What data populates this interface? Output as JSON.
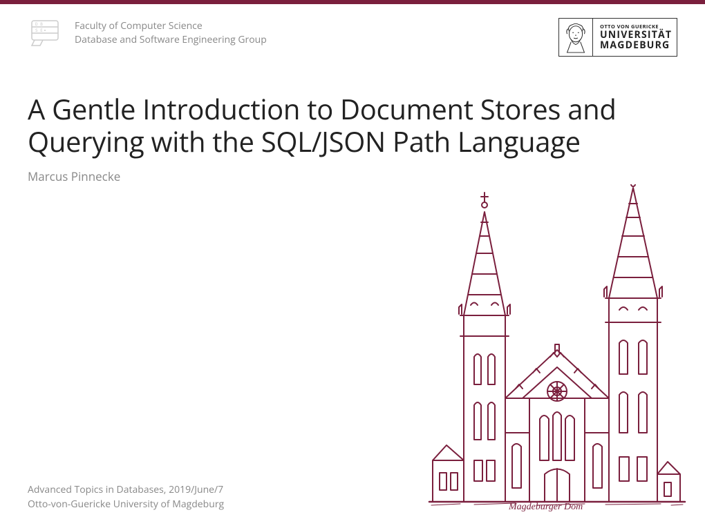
{
  "header": {
    "faculty": "Faculty of Computer Science",
    "group": "Database and Software Engineering Group"
  },
  "university_logo": {
    "line1": "OTTO VON GUERICKE",
    "line2": "UNIVERSITÄT",
    "line3": "MAGDEBURG"
  },
  "main": {
    "title": "A Gentle Introduction to Document Stores and Querying with the SQL/JSON Path Language",
    "author": "Marcus Pinnecke"
  },
  "footer": {
    "line1": "Advanced Topics in Databases, 2019/June/7",
    "line2": "Otto-von-Guericke University of Magdeburg"
  },
  "illustration": {
    "caption": "Magdeburger Dom"
  }
}
